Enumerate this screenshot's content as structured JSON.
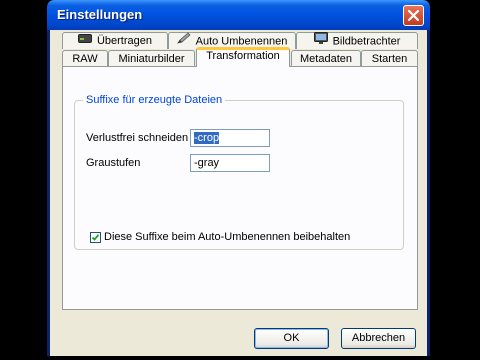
{
  "window": {
    "title": "Einstellungen"
  },
  "tabs_back": [
    {
      "label": "Übertragen",
      "icon": "drive-icon"
    },
    {
      "label": "Auto Umbenennen",
      "icon": "pencil-icon"
    },
    {
      "label": "Bildbetrachter",
      "icon": "monitor-icon"
    }
  ],
  "tabs_front": [
    {
      "label": "RAW"
    },
    {
      "label": "Miniaturbilder"
    },
    {
      "label": "Transformation",
      "active": true
    },
    {
      "label": "Metadaten"
    },
    {
      "label": "Starten"
    }
  ],
  "group": {
    "title": "Suffixe für erzeugte Dateien",
    "rows": [
      {
        "label": "Verlustfrei schneiden",
        "value": "-crop"
      },
      {
        "label": "Graustufen",
        "value": "-gray"
      }
    ],
    "checkbox": {
      "label": "Diese Suffixe beim Auto-Umbenennen beibehalten",
      "checked": true
    }
  },
  "buttons": {
    "ok": "OK",
    "cancel": "Abbrechen"
  }
}
